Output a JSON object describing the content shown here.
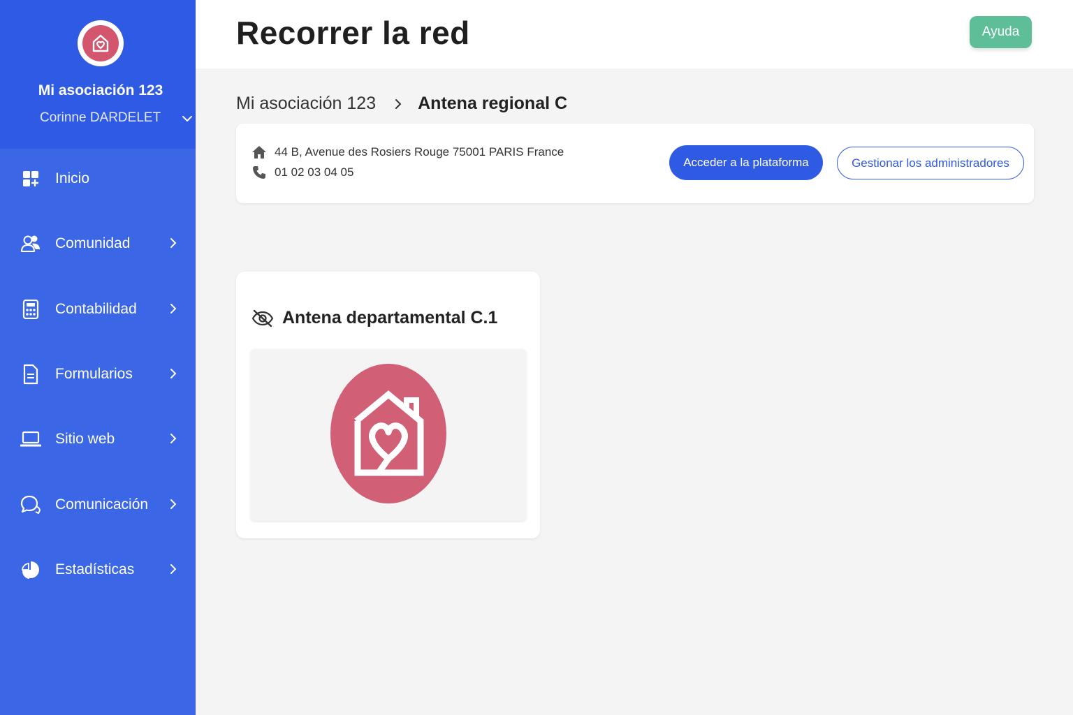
{
  "sidebar": {
    "org_name": "Mi asociación 123",
    "user_name": "Corinne DARDELET",
    "items": [
      {
        "label": "Inicio",
        "icon": "dashboard-icon",
        "has_submenu": false
      },
      {
        "label": "Comunidad",
        "icon": "users-icon",
        "has_submenu": true
      },
      {
        "label": "Contabilidad",
        "icon": "calculator-icon",
        "has_submenu": true
      },
      {
        "label": "Formularios",
        "icon": "document-icon",
        "has_submenu": true
      },
      {
        "label": "Sitio web",
        "icon": "laptop-icon",
        "has_submenu": true
      },
      {
        "label": "Comunicación",
        "icon": "chat-icon",
        "has_submenu": true
      },
      {
        "label": "Estadísticas",
        "icon": "pie-chart-icon",
        "has_submenu": true
      }
    ]
  },
  "header": {
    "title": "Recorrer la red",
    "help_label": "Ayuda"
  },
  "breadcrumb": {
    "parent": "Mi asociación 123",
    "current": "Antena regional C"
  },
  "info": {
    "address": "44 B, Avenue des Rosiers Rouge 75001 PARIS France",
    "phone": "01 02 03 04 05",
    "access_label": "Acceder a la plataforma",
    "manage_label": "Gestionar los administradores"
  },
  "children": [
    {
      "name": "Antena departamental C.1",
      "icon": "eye-off-icon"
    }
  ],
  "colors": {
    "sidebar": "#3b67e6",
    "sidebar_header": "#2f5ae3",
    "primary": "#2f5ae3",
    "help": "#5dbe98",
    "logo": "#d15f76"
  }
}
